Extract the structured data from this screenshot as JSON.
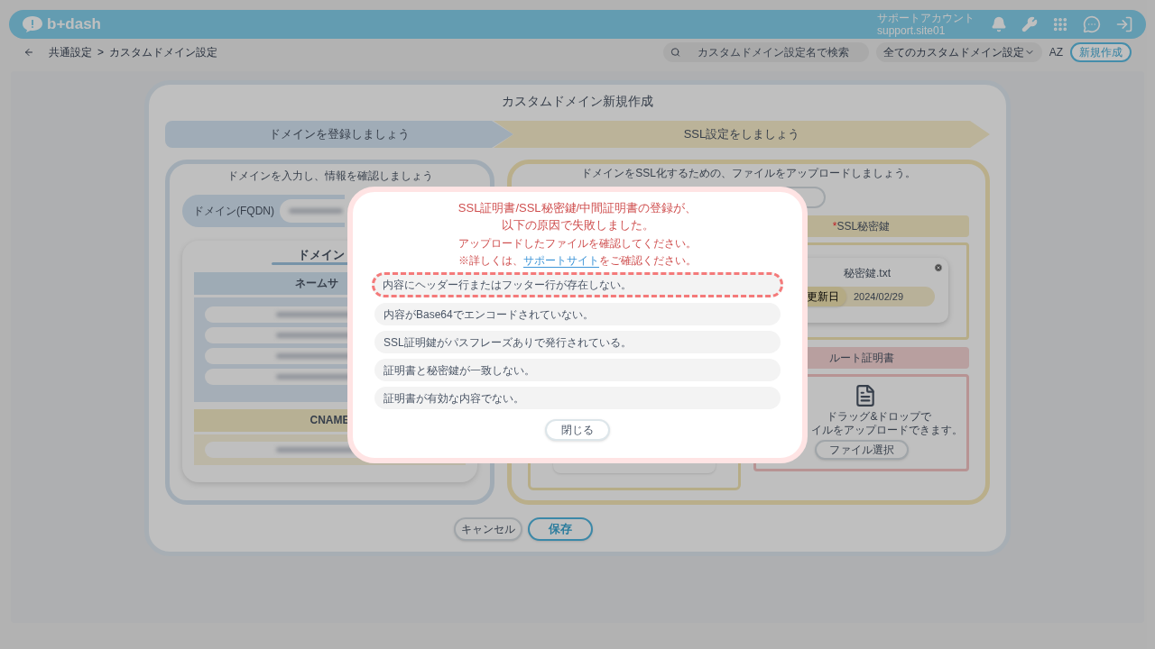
{
  "header": {
    "logo": "b+dash",
    "account_name": "サポートアカウント",
    "account_id": "support.site01"
  },
  "toolbar": {
    "breadcrumb": [
      "共通設定",
      "カスタムドメイン設定"
    ],
    "separator": ">",
    "search": {
      "placeholder": "カスタムドメイン設定名で検索"
    },
    "filter": "全てのカスタムドメイン設定",
    "sort_label": "AZ",
    "new_button": "新規作成"
  },
  "dialog": {
    "title": "カスタムドメイン新規作成",
    "steps": [
      {
        "label": "ドメインを登録しましょう",
        "kind": "domain"
      },
      {
        "label": "SSL設定をしましょう",
        "kind": "ssl"
      }
    ],
    "domain_panel": {
      "heading": "ドメインを入力し、情報を確認しましょう",
      "field_label": "ドメイン(FQDN)",
      "info_heading": "ドメイン",
      "nameserver_label": "ネームサ",
      "cname_label": "CNAME"
    },
    "ssl_panel": {
      "heading": "ドメインをSSL化するための、ファイルをアップロードしましょう。",
      "private_key": {
        "required_mark": "*",
        "label": "SSL秘密鍵",
        "file_name": "秘密鍵.txt",
        "date_label": "更新日",
        "date": "2024/02/29"
      },
      "root_cert": {
        "label": "ルート証明書",
        "drop_line1": "ドラッグ&ドロップで",
        "drop_line2": "イルをアップロードできます。",
        "select_button": "ファイル選択"
      }
    },
    "buttons": [
      {
        "label": "キャンセル",
        "kind": "secondary"
      },
      {
        "label": "保存",
        "kind": "primary"
      }
    ]
  },
  "error_modal": {
    "title_lines": [
      "SSL証明書/SSL秘密鍵/中間証明書の登録が、",
      "以下の原因で失敗しました。"
    ],
    "subtitle": "アップロードしたファイルを確認してください。",
    "note": {
      "before": "※詳しくは、",
      "link": "サポートサイト",
      "after": "をご確認ください。"
    },
    "reasons": [
      {
        "text": "内容にヘッダー行またはフッター行が存在しない。",
        "highlighted": true
      },
      {
        "text": "内容がBase64でエンコードされていない。",
        "highlighted": false
      },
      {
        "text": "SSL証明鍵がパスフレーズありで発行されている。",
        "highlighted": false
      },
      {
        "text": "証明書と秘密鍵が一致しない。",
        "highlighted": false
      },
      {
        "text": "証明書が有効な内容でない。",
        "highlighted": false
      }
    ],
    "close_button": "閉じる"
  }
}
